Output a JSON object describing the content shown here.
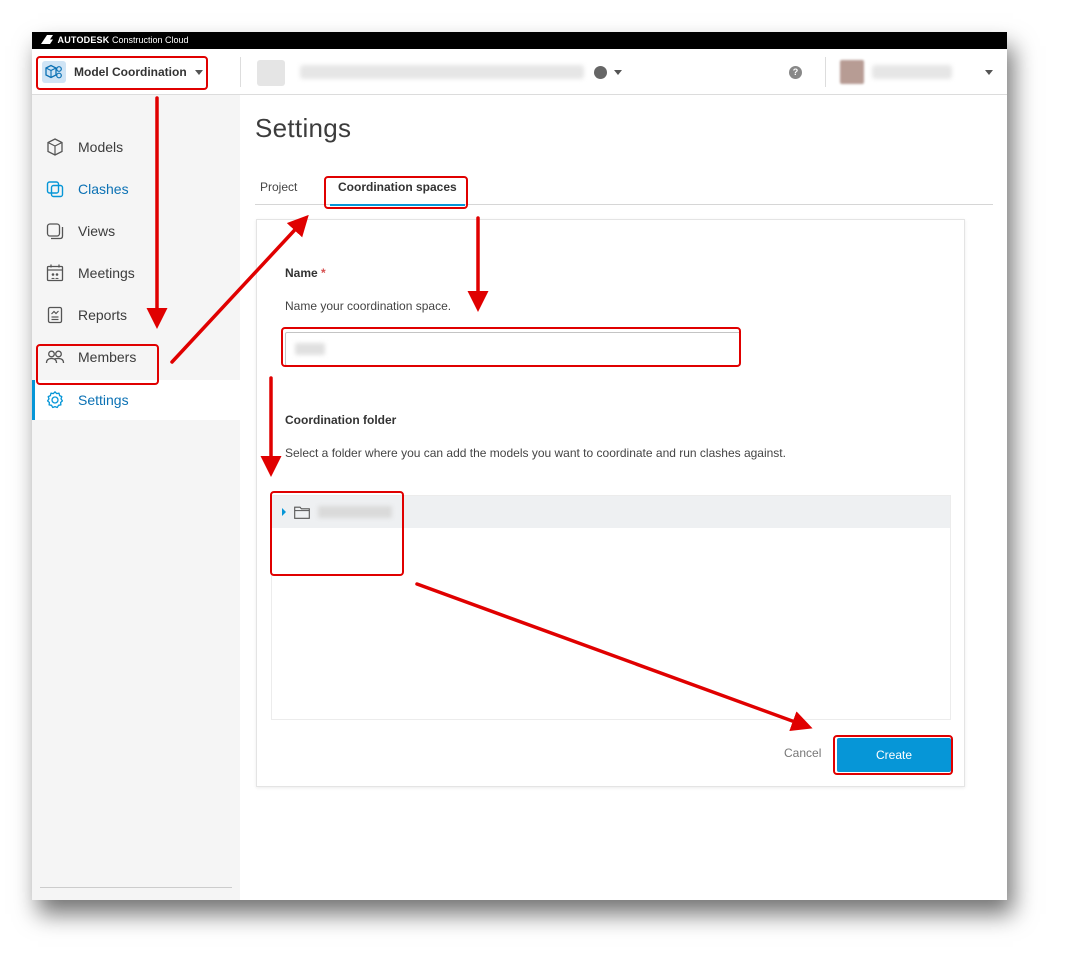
{
  "brand": {
    "name": "AUTODESK",
    "product": "Construction Cloud"
  },
  "header": {
    "module": "Model Coordination",
    "help_label": "?"
  },
  "sidebar": {
    "items": [
      {
        "label": "Models"
      },
      {
        "label": "Clashes"
      },
      {
        "label": "Views"
      },
      {
        "label": "Meetings"
      },
      {
        "label": "Reports"
      },
      {
        "label": "Members"
      },
      {
        "label": "Settings"
      }
    ],
    "collapse_glyph": "|←"
  },
  "main": {
    "title": "Settings",
    "tabs": [
      {
        "label": "Project"
      },
      {
        "label": "Coordination spaces"
      }
    ],
    "form": {
      "name_label": "Name",
      "required_mark": "*",
      "name_desc": "Name your coordination space.",
      "name_value": "",
      "folder_label": "Coordination folder",
      "folder_desc": "Select a folder where you can add the models you want to coordinate and run clashes against.",
      "cancel_label": "Cancel",
      "create_label": "Create"
    }
  },
  "colors": {
    "accent": "#0696d7",
    "active_text": "#0b71b4",
    "annotation": "#e00000"
  }
}
